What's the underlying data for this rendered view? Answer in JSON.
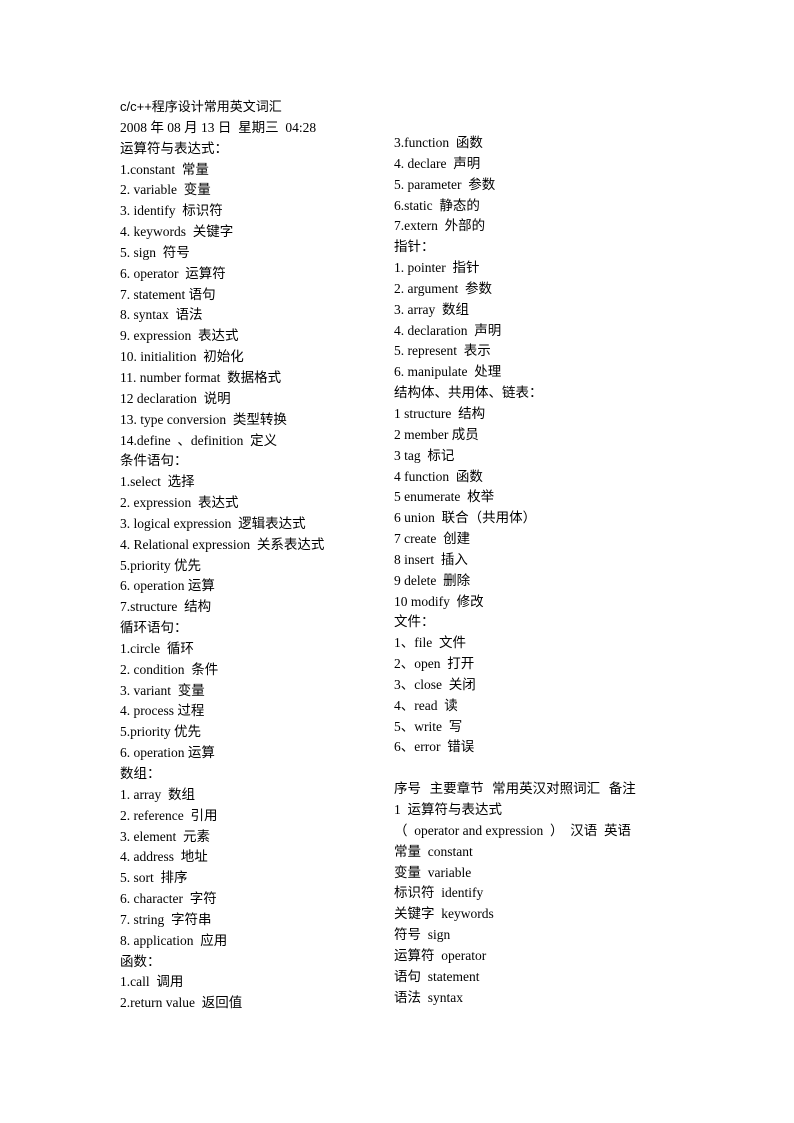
{
  "document": {
    "title": "c/c++程序设计常用英文词汇",
    "datetime": "2008 年 08 月 13 日  星期三  04:28"
  },
  "left_column": [
    {
      "type": "heading",
      "text": "运算符与表达式："
    },
    {
      "type": "item",
      "text": "1.constant  常量"
    },
    {
      "type": "item",
      "text": "2. variable  变量"
    },
    {
      "type": "item",
      "text": "3. identify  标识符"
    },
    {
      "type": "item",
      "text": "4. keywords  关键字"
    },
    {
      "type": "item",
      "text": "5. sign  符号"
    },
    {
      "type": "item",
      "text": "6. operator  运算符"
    },
    {
      "type": "item",
      "text": "7. statement 语句"
    },
    {
      "type": "item",
      "text": "8. syntax  语法"
    },
    {
      "type": "item",
      "text": "9. expression  表达式"
    },
    {
      "type": "item",
      "text": "10. initialition  初始化"
    },
    {
      "type": "item",
      "text": "11. number format  数据格式"
    },
    {
      "type": "item",
      "text": "12 declaration  说明"
    },
    {
      "type": "item",
      "text": "13. type conversion  类型转换"
    },
    {
      "type": "item",
      "text": "14.define  、definition  定义"
    },
    {
      "type": "heading",
      "text": "条件语句："
    },
    {
      "type": "item",
      "text": "1.select  选择"
    },
    {
      "type": "item",
      "text": "2. expression  表达式"
    },
    {
      "type": "item",
      "text": "3. logical expression  逻辑表达式"
    },
    {
      "type": "item",
      "text": "4. Relational expression  关系表达式"
    },
    {
      "type": "item",
      "text": "5.priority 优先"
    },
    {
      "type": "item",
      "text": "6. operation 运算"
    },
    {
      "type": "item",
      "text": "7.structure  结构"
    },
    {
      "type": "heading",
      "text": "循环语句："
    },
    {
      "type": "item",
      "text": "1.circle  循环"
    },
    {
      "type": "item",
      "text": "2. condition  条件"
    },
    {
      "type": "item",
      "text": "3. variant  变量"
    },
    {
      "type": "item",
      "text": "4. process 过程"
    },
    {
      "type": "item",
      "text": "5.priority 优先"
    },
    {
      "type": "item",
      "text": "6. operation 运算"
    },
    {
      "type": "heading",
      "text": "数组："
    },
    {
      "type": "item",
      "text": "1. array  数组"
    },
    {
      "type": "item",
      "text": "2. reference  引用"
    },
    {
      "type": "item",
      "text": "3. element  元素"
    },
    {
      "type": "item",
      "text": "4. address  地址"
    },
    {
      "type": "item",
      "text": "5. sort  排序"
    },
    {
      "type": "item",
      "text": "6. character  字符"
    },
    {
      "type": "item",
      "text": "7. string  字符串"
    },
    {
      "type": "item",
      "text": "8. application  应用"
    },
    {
      "type": "heading",
      "text": "函数："
    },
    {
      "type": "item",
      "text": "1.call  调用"
    },
    {
      "type": "item",
      "text": "2.return value  返回值"
    }
  ],
  "right_column": [
    {
      "type": "item",
      "text": "3.function  函数"
    },
    {
      "type": "item",
      "text": "4. declare  声明"
    },
    {
      "type": "item",
      "text": "5. parameter  参数"
    },
    {
      "type": "item",
      "text": "6.static  静态的"
    },
    {
      "type": "item",
      "text": "7.extern  外部的"
    },
    {
      "type": "heading",
      "text": "指针："
    },
    {
      "type": "item",
      "text": "1. pointer  指针"
    },
    {
      "type": "item",
      "text": "2. argument  参数"
    },
    {
      "type": "item",
      "text": "3. array  数组"
    },
    {
      "type": "item",
      "text": "4. declaration  声明"
    },
    {
      "type": "item",
      "text": "5. represent  表示"
    },
    {
      "type": "item",
      "text": "6. manipulate  处理"
    },
    {
      "type": "heading",
      "text": "结构体、共用体、链表："
    },
    {
      "type": "item",
      "text": "1 structure  结构"
    },
    {
      "type": "item",
      "text": "2 member 成员"
    },
    {
      "type": "item",
      "text": "3 tag  标记"
    },
    {
      "type": "item",
      "text": "4 function  函数"
    },
    {
      "type": "item",
      "text": "5 enumerate  枚举"
    },
    {
      "type": "item",
      "text": "6 union  联合（共用体）"
    },
    {
      "type": "item",
      "text": "7 create  创建"
    },
    {
      "type": "item",
      "text": "8 insert  插入"
    },
    {
      "type": "item",
      "text": "9 delete  删除"
    },
    {
      "type": "item",
      "text": "10 modify  修改"
    },
    {
      "type": "heading",
      "text": "文件："
    },
    {
      "type": "item",
      "text": "1、file  文件"
    },
    {
      "type": "item",
      "text": "2、open  打开"
    },
    {
      "type": "item",
      "text": "3、close  关闭"
    },
    {
      "type": "item",
      "text": "4、read  读"
    },
    {
      "type": "item",
      "text": "5、write  写"
    },
    {
      "type": "item",
      "text": "6、error  错误"
    },
    {
      "type": "blank",
      "text": ""
    },
    {
      "type": "heading",
      "text": "序号  主要章节  常用英汉对照词汇  备注"
    },
    {
      "type": "item",
      "text": "1  运算符与表达式"
    },
    {
      "type": "item",
      "text": "（  operator and expression  ）  汉语  英语"
    },
    {
      "type": "item",
      "text": "常量  constant"
    },
    {
      "type": "item",
      "text": "变量  variable"
    },
    {
      "type": "item",
      "text": "标识符  identify"
    },
    {
      "type": "item",
      "text": "关键字  keywords"
    },
    {
      "type": "item",
      "text": "符号  sign"
    },
    {
      "type": "item",
      "text": "运算符  operator"
    },
    {
      "type": "item",
      "text": "语句  statement"
    },
    {
      "type": "item",
      "text": "语法  syntax"
    }
  ]
}
